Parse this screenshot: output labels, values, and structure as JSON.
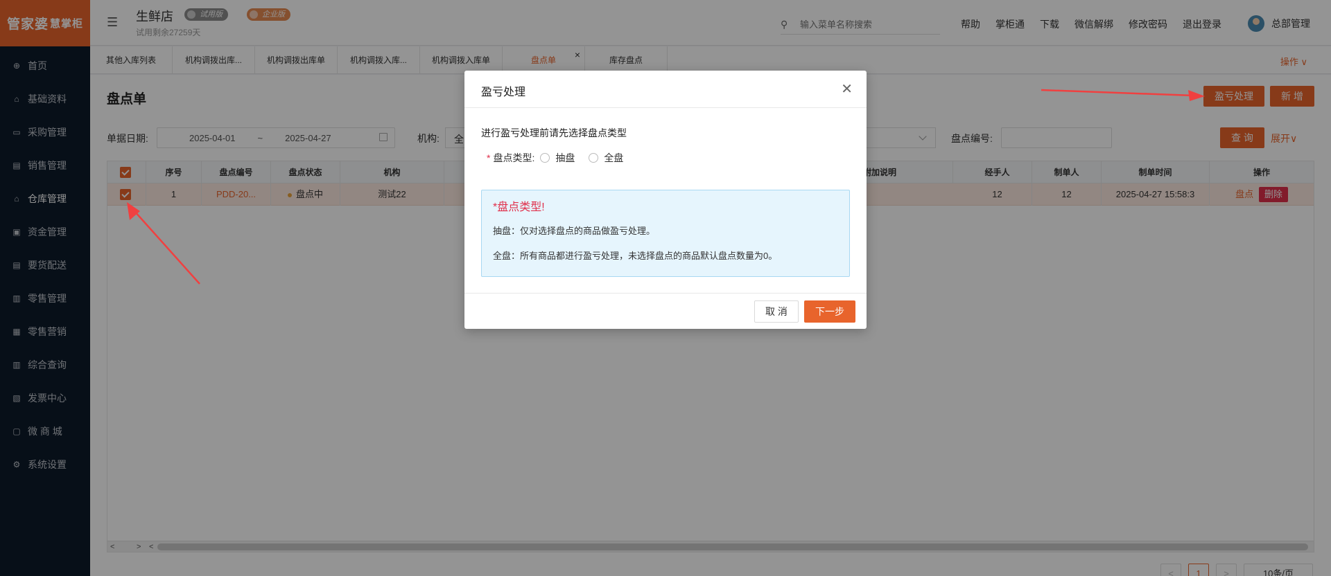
{
  "brand": {
    "logo_main": "管家婆",
    "logo_sub": "慧掌柜"
  },
  "sidebar": {
    "items": [
      {
        "label": "首页",
        "icon": "globe-icon"
      },
      {
        "label": "基础资料",
        "icon": "home-icon"
      },
      {
        "label": "采购管理",
        "icon": "cart-icon"
      },
      {
        "label": "销售管理",
        "icon": "sales-icon"
      },
      {
        "label": "仓库管理",
        "icon": "warehouse-icon"
      },
      {
        "label": "资金管理",
        "icon": "money-icon"
      },
      {
        "label": "要货配送",
        "icon": "delivery-icon"
      },
      {
        "label": "零售管理",
        "icon": "chart-icon"
      },
      {
        "label": "零售营销",
        "icon": "gift-icon"
      },
      {
        "label": "综合查询",
        "icon": "bar-chart-icon"
      },
      {
        "label": "发票中心",
        "icon": "invoice-icon"
      },
      {
        "label": "微 商 城",
        "icon": "bag-icon"
      },
      {
        "label": "系统设置",
        "icon": "gear-icon"
      }
    ]
  },
  "header": {
    "store_name": "生鲜店",
    "badge_trial": "试用版",
    "badge_enterprise": "企业版",
    "trial_remaining": "试用剩余27259天",
    "search_placeholder": "输入菜单名称搜索",
    "links": [
      "帮助",
      "掌柜通",
      "下载",
      "微信解绑",
      "修改密码",
      "退出登录"
    ],
    "user_name": "总部管理"
  },
  "tabs": {
    "items": [
      "其他入库列表",
      "机构调拨出库...",
      "机构调拨出库单",
      "机构调拨入库...",
      "机构调拨入库单",
      "盘点单",
      "库存盘点"
    ],
    "close_symbol": "×",
    "operations_label": "操作 ∨"
  },
  "page": {
    "title": "盘点单",
    "btn_loss": "盈亏处理",
    "btn_add": "新 增",
    "filter_date_label": "单据日期:",
    "date_start": "2025-04-01",
    "date_sep": "~",
    "date_end": "2025-04-27",
    "filter_org_label": "机构:",
    "filter_org_value": "全",
    "filter_code_label": "盘点编号:",
    "btn_query": "查 询",
    "expand_label": "展开∨"
  },
  "table": {
    "headers": {
      "seq": "序号",
      "code": "盘点编号",
      "status": "盘点状态",
      "org": "机构",
      "extra": "附加说明",
      "handler": "经手人",
      "creator": "制单人",
      "created_at": "制单时间",
      "ops": "操作"
    },
    "rows": [
      {
        "seq": "1",
        "code": "PDD-20...",
        "status": "盘点中",
        "org": "测试22",
        "handler": "12",
        "creator": "12",
        "created_at": "2025-04-27 15:58:3",
        "op_count": "盘点",
        "op_delete": "删除"
      }
    ]
  },
  "pager": {
    "current": "1",
    "page_size": "10条/页"
  },
  "dialog": {
    "title": "盈亏处理",
    "description": "进行盈亏处理前请先选择盘点类型",
    "field_label": "盘点类型:",
    "option_partial": "抽盘",
    "option_full": "全盘",
    "info_title": "*盘点类型!",
    "info_partial": "抽盘：仅对选择盘点的商品做盈亏处理。",
    "info_full": "全盘：所有商品都进行盈亏处理，未选择盘点的商品默认盘点数量为0。",
    "btn_cancel": "取 消",
    "btn_next": "下一步"
  }
}
